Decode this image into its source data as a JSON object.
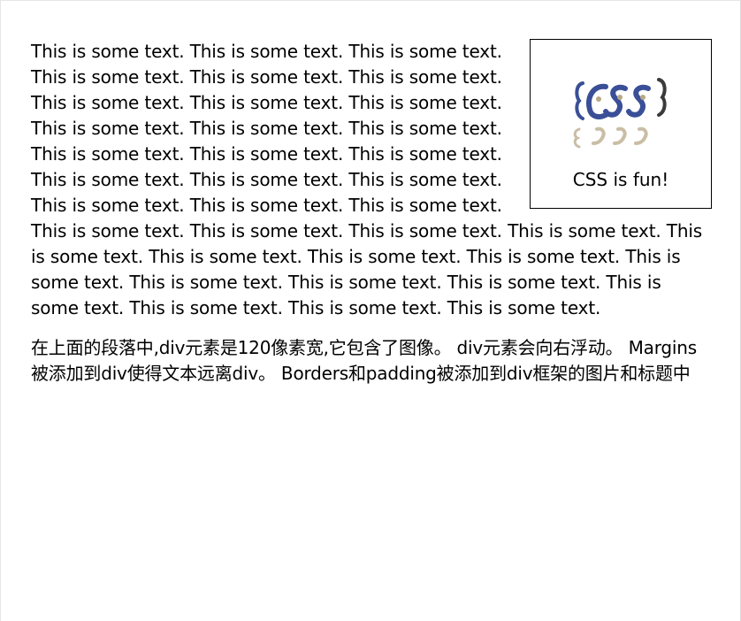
{
  "float_box": {
    "logo_text": "CSS",
    "logo_label": "css-logo",
    "caption": "CSS is fun!"
  },
  "paragraph_main": "This is some text. This is some text. This is some text. This is some text. This is some text. This is some text. This is some text. This is some text. This is some text. This is some text. This is some text. This is some text. This is some text. This is some text. This is some text. This is some text. This is some text. This is some text. This is some text. This is some text. This is some text. This is some text. This is some text. This is some text. This is some text. This is some text. This is some text. This is some text. This is some text. This is some text. This is some text. This is some text. This is some text. This is some text. This is some text. This is some text. This is some text.",
  "paragraph_note": "在上面的段落中,div元素是120像素宽,它包含了图像。 div元素会向右浮动。 Margins 被添加到div使得文本远离div。 Borders和padding被添加到div框架的图片和标题中",
  "colors": {
    "logo_blue": "#3a4f97",
    "logo_tan": "#b8a888",
    "logo_brace": "#3b3b3b"
  }
}
